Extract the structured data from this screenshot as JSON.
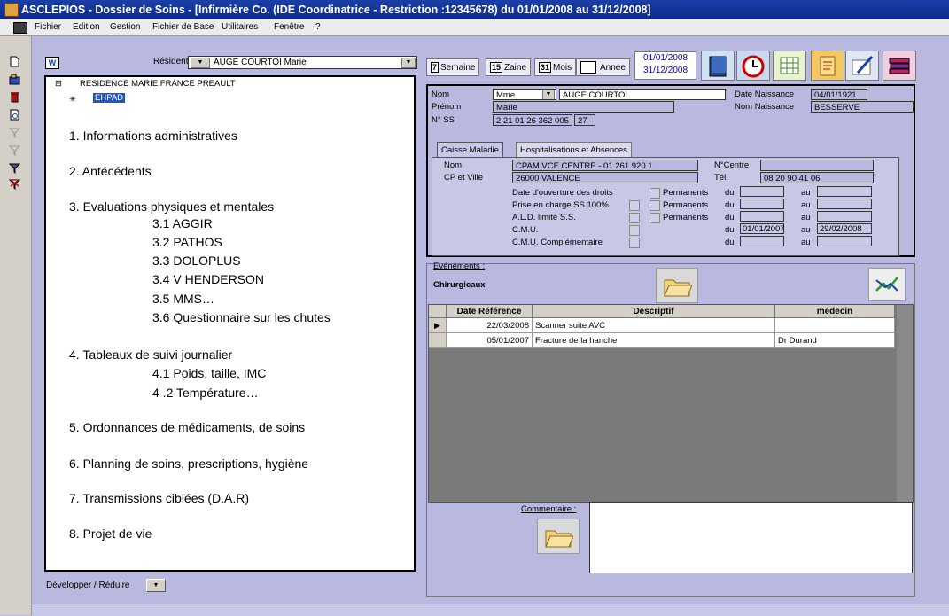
{
  "window": {
    "title": "ASCLEPIOS - Dossier de Soins - [Infirmière Co. (IDE Coordinatrice - Restriction :12345678) du 01/01/2008 au 31/12/2008]"
  },
  "menu": [
    "Fichier",
    "Edition",
    "Gestion",
    "Fichier de Base",
    "Utilitaires",
    "Fenêtre",
    "?"
  ],
  "resident": {
    "label": "Résident",
    "value": "AUGE COURTOI Marie"
  },
  "tree": {
    "root": "RESIDENCE MARIE FRANCE PREAULT",
    "child": "EHPAD"
  },
  "sections": [
    {
      "title": "1. Informations administratives",
      "sub": []
    },
    {
      "title": "2. Antécédents",
      "sub": []
    },
    {
      "title": "3. Evaluations physiques et mentales",
      "sub": [
        "3.1 AGGIR",
        "3.2 PATHOS",
        "3.3 DOLOPLUS",
        "3.4 V HENDERSON",
        "3.5 MMS…",
        "3.6 Questionnaire sur les chutes"
      ]
    },
    {
      "title": "4. Tableaux de suivi journalier",
      "sub": [
        "4.1 Poids, taille, IMC",
        "4 .2 Température…"
      ]
    },
    {
      "title": "5. Ordonnances de médicaments, de soins",
      "sub": []
    },
    {
      "title": "6. Planning de soins, prescriptions, hygiène",
      "sub": []
    },
    {
      "title": "7. Transmissions ciblées (D.A.R)",
      "sub": []
    },
    {
      "title": "8. Projet de vie",
      "sub": []
    }
  ],
  "expand_label": "Développer / Réduire",
  "period": {
    "semaine_num": "7",
    "semaine": "Semaine",
    "zaine_num": "15",
    "zaine": "Zaine",
    "mois_num": "31",
    "mois": "Mois",
    "annee": "Annee",
    "date_from": "01/01/2008",
    "date_to": "31/12/2008"
  },
  "identity": {
    "nom_label": "Nom",
    "civilite": "Mme",
    "nom": "AUGE COURTOI",
    "prenom_label": "Prénom",
    "prenom": "Marie",
    "nss_label": "N° SS",
    "nss": "2 21 01 26 362 005",
    "nss_key": "27",
    "naissance_label": "Date Naissance",
    "naissance": "04/01/1921",
    "nom_naissance_label": "Nom Naissance",
    "nom_naissance": "BESSERVE"
  },
  "tabs": [
    "Caisse Maladie",
    "Hospitalisations et Absences"
  ],
  "caisse": {
    "nom_label": "Nom",
    "nom": "CPAM VCE CENTRE - 01 261 920 1",
    "cp_label": "CP et Ville",
    "cp": "26000 VALENCE",
    "centre_label": "N°Centre",
    "centre": "",
    "tel_label": "Tél.",
    "tel": "08 20 90 41 06",
    "rows": [
      {
        "label": "Date d'ouverture des droits",
        "perm": "Permanents",
        "du_label": "du",
        "du": "",
        "au_label": "au",
        "au": ""
      },
      {
        "label": "Prise en charge SS 100%",
        "perm": "Permanents",
        "du_label": "du",
        "du": "",
        "au_label": "au",
        "au": ""
      },
      {
        "label": "A.L.D. limité S.S.",
        "perm": "Permanents",
        "du_label": "du",
        "du": "",
        "au_label": "au",
        "au": ""
      },
      {
        "label": "C.M.U.",
        "perm": "",
        "du_label": "du",
        "du": "01/01/2007",
        "au_label": "au",
        "au": "29/02/2008"
      },
      {
        "label": "C.M.U. Complémentaire",
        "perm": "",
        "du_label": "du",
        "du": "",
        "au_label": "au",
        "au": ""
      }
    ]
  },
  "events": {
    "label": "Evénements :",
    "type": "Chirurgicaux",
    "columns": [
      "Date Référence",
      "Descriptif",
      "médecin"
    ],
    "rows": [
      {
        "date": "22/03/2008",
        "desc": "Scanner suite AVC",
        "medecin": ""
      },
      {
        "date": "05/01/2007",
        "desc": "Fracture de la hanche",
        "medecin": "Dr Durand"
      }
    ],
    "comment_label": "Commentaire :"
  }
}
